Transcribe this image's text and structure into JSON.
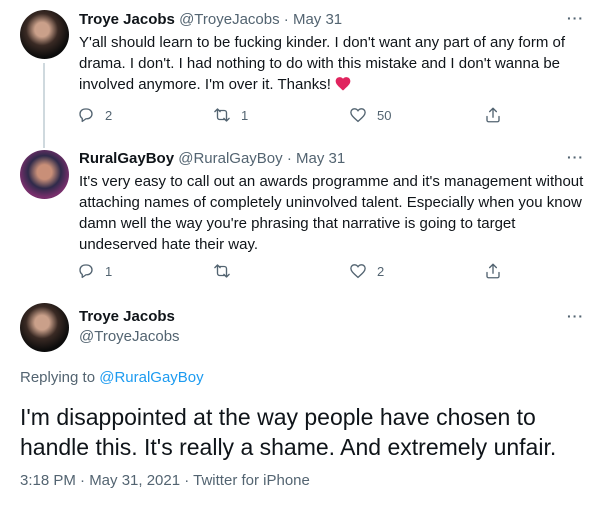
{
  "tweets": [
    {
      "name": "Troye Jacobs",
      "handle": "@TroyeJacobs",
      "date": "May 31",
      "text": "Y'all should learn to be fucking kinder. I don't want any part of any form of drama. I don't. I had nothing to do with this mistake and I don't wanna be involved anymore. I'm over it. Thanks!",
      "replies": "2",
      "retweets": "1",
      "likes": "50"
    },
    {
      "name": "RuralGayBoy",
      "handle": "@RuralGayBoy",
      "date": "May 31",
      "text": "It's very easy to call out an awards programme and it's management without attaching names of completely uninvolved talent. Especially when you know damn well the way you're phrasing that narrative is going to target undeserved hate their way.",
      "replies": "1",
      "retweets": "",
      "likes": "2"
    }
  ],
  "focus": {
    "name": "Troye Jacobs",
    "handle": "@TroyeJacobs",
    "replying_prefix": "Replying to",
    "replying_to": "@RuralGayBoy",
    "text": "I'm disappointed at the way people have chosen to handle this. It's really a shame. And extremely unfair.",
    "timestamp": "3:18 PM · May 31, 2021 · Twitter for iPhone"
  },
  "ui": {
    "more_label": "···",
    "dot": " · ",
    "heart_color": "#e0245e"
  }
}
